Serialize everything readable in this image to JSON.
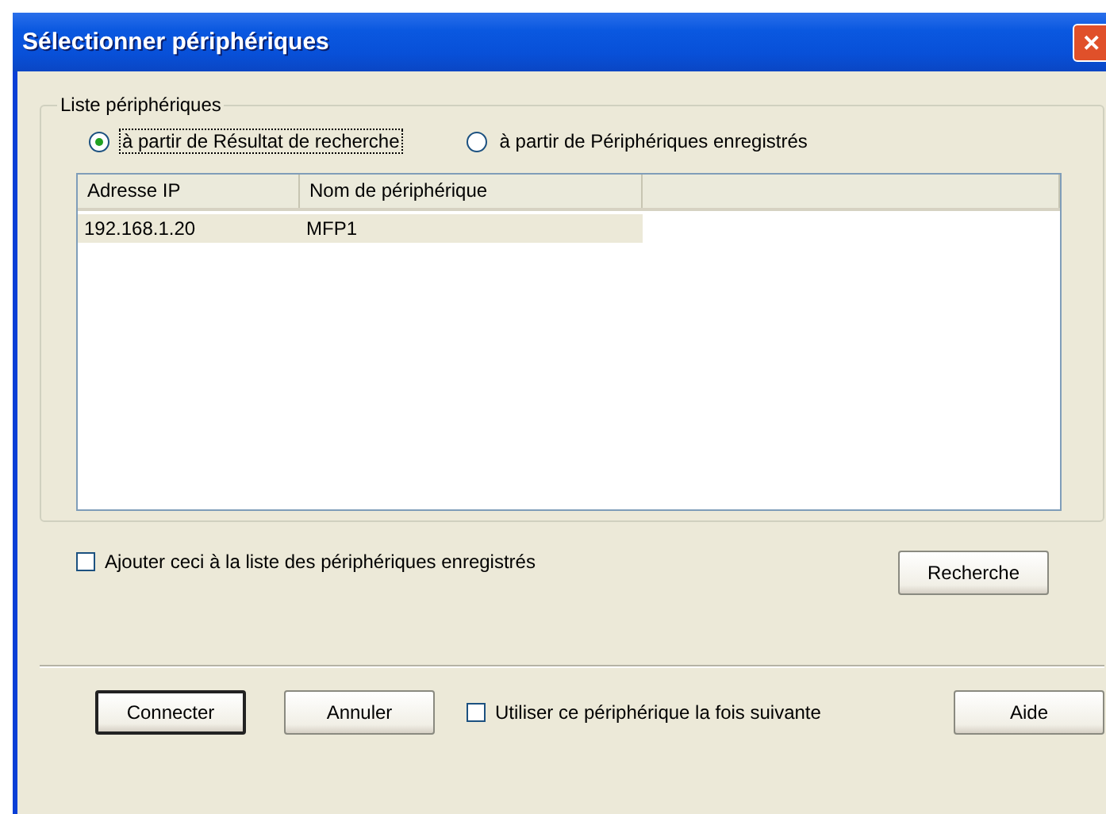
{
  "window": {
    "title": "Sélectionner périphériques",
    "close": "✕"
  },
  "group": {
    "legend": "Liste périphériques",
    "sources": [
      {
        "label": "à partir de Résultat de recherche",
        "selected": true
      },
      {
        "label": "à partir de Périphériques enregistrés",
        "selected": false
      }
    ],
    "table": {
      "columns": [
        "Adresse IP",
        "Nom de périphérique"
      ],
      "rows": [
        {
          "cells": [
            "192.168.1.20",
            "MFP1"
          ],
          "selected": true
        }
      ]
    }
  },
  "add_to_registered": {
    "label": "Ajouter ceci à la liste des périphériques enregistrés",
    "checked": false
  },
  "search_button": "Recherche",
  "footer": {
    "connect": "Connecter",
    "cancel": "Annuler",
    "use_next_time": {
      "label": "Utiliser ce périphérique la fois suivante",
      "checked": false
    },
    "help": "Aide"
  }
}
